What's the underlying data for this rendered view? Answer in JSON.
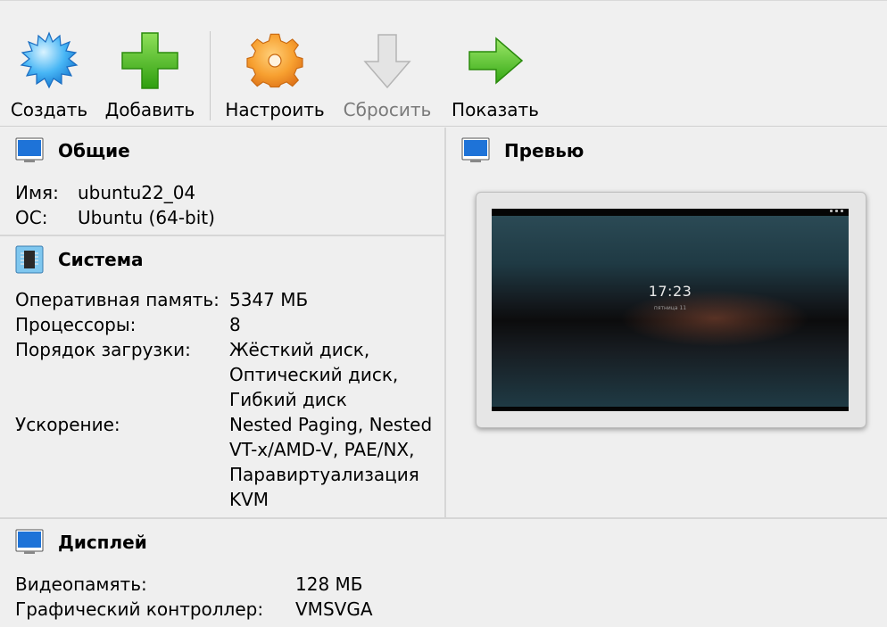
{
  "toolbar": {
    "buttons": [
      {
        "id": "create",
        "label": "Создать",
        "icon": "create-starburst-icon",
        "enabled": true
      },
      {
        "id": "add",
        "label": "Добавить",
        "icon": "add-plus-icon",
        "enabled": true
      },
      {
        "id": "settings",
        "label": "Настроить",
        "icon": "gear-icon",
        "enabled": true
      },
      {
        "id": "discard",
        "label": "Сбросить",
        "icon": "discard-down-arrow-icon",
        "enabled": false
      },
      {
        "id": "show",
        "label": "Показать",
        "icon": "show-right-arrow-icon",
        "enabled": true
      }
    ]
  },
  "general": {
    "title": "Общие",
    "icon": "monitor-icon",
    "rows": [
      {
        "key": "Имя:",
        "value": "ubuntu22_04"
      },
      {
        "key": "ОС:",
        "value": "Ubuntu (64-bit)"
      }
    ]
  },
  "system": {
    "title": "Система",
    "icon": "chip-icon",
    "rows": [
      {
        "key": "Оперативная память:",
        "lines": [
          "5347 МБ"
        ]
      },
      {
        "key": "Процессоры:",
        "lines": [
          "8"
        ]
      },
      {
        "key": "Порядок загрузки:",
        "lines": [
          "Жёсткий диск,",
          "Оптический диск,",
          "Гибкий диск"
        ]
      },
      {
        "key": "Ускорение:",
        "lines": [
          "Nested Paging, Nested",
          "VT-x/AMD-V, PAE/NX,",
          "Паравиртуализация",
          "KVM"
        ]
      }
    ]
  },
  "preview": {
    "title": "Превью",
    "icon": "monitor-icon",
    "clock": "17:23",
    "date": "пятница 11"
  },
  "display": {
    "title": "Дисплей",
    "icon": "monitor-icon",
    "rows": [
      {
        "key": "Видеопамять:",
        "value": "128 МБ"
      },
      {
        "key": "Графический контроллер:",
        "value": "VMSVGA"
      }
    ]
  },
  "colors": {
    "accent_blue": "#1e73d8",
    "add_green": "#3cb815",
    "gear_orange": "#f28a1c",
    "disabled_gray": "#7a7a7a"
  }
}
